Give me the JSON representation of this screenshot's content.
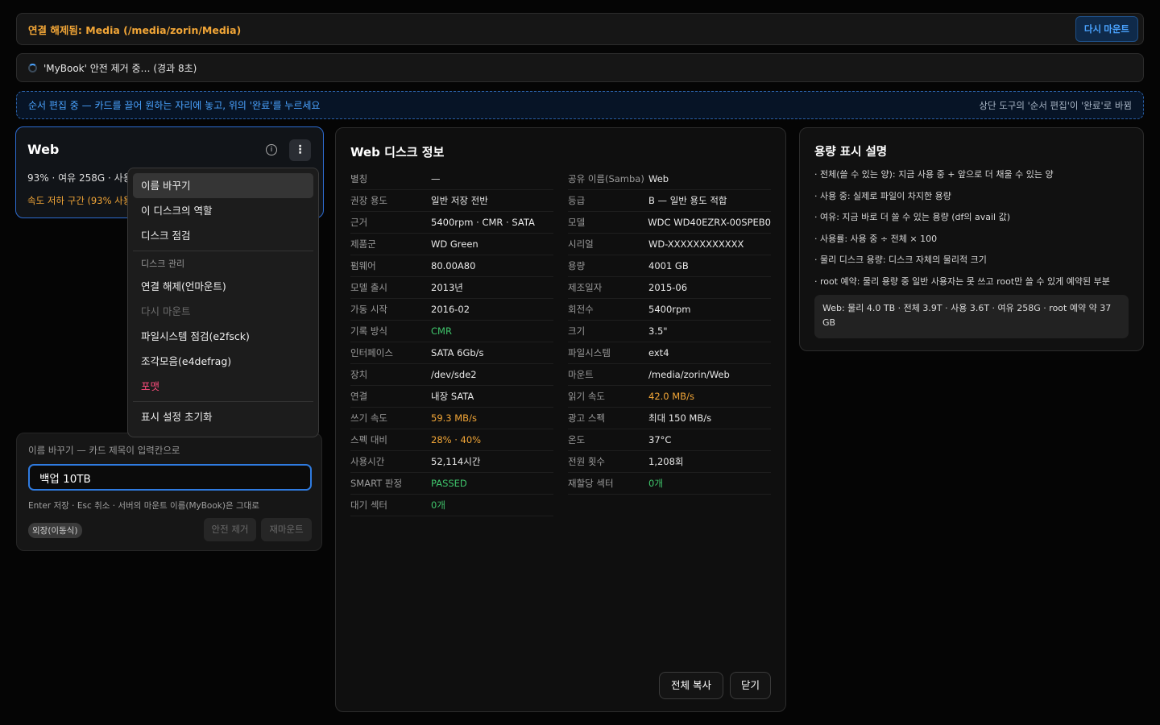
{
  "unmount_bar": {
    "message": "연결 해제됨: Media (/media/zorin/Media)",
    "remount_label": "다시 마운트"
  },
  "eject_bar": {
    "message": "'MyBook' 안전 제거 중… (경과 8초)"
  },
  "order_bar": {
    "left": "순서 편집 중 — 카드를 끌어 원하는 자리에 놓고, 위의 '완료'를 누르세요",
    "right": "상단 도구의 '순서 편집'이 '완료'로 바뀜"
  },
  "web_card": {
    "title": "Web",
    "subtitle": "93% · 여유 258G · 사용",
    "warning": "속도 저하 구간 (93% 사용",
    "info_glyph": "i",
    "kebab_glyph": "⋮"
  },
  "menu": {
    "items_top": [
      "이름 바꾸기",
      "이 디스크의 역할",
      "디스크 점검"
    ],
    "section_header": "디스크 관리",
    "items_manage": [
      "연결 해제(언마운트)",
      "다시 마운트",
      "파일시스템 점검(e2fsck)",
      "조각모음(e4defrag)",
      "포맷"
    ],
    "reset": "표시 설정 초기화"
  },
  "rename_card": {
    "label": "이름 바꾸기 — 카드 제목이 입력칸으로",
    "input_value": "백업 10TB",
    "hint": "Enter 저장 · Esc 취소 · 서버의 마운트 이름(MyBook)은 그대로",
    "badge": "외장(이동식)",
    "eject_label": "안전 제거",
    "remount_label": "재마운트"
  },
  "info_panel": {
    "title": "Web 디스크 정보",
    "left_rows": [
      {
        "k": "별칭",
        "v": "—"
      },
      {
        "k": "권장 용도",
        "v": "일반 저장 전반"
      },
      {
        "k": "근거",
        "v": "5400rpm · CMR · SATA"
      },
      {
        "k": "제품군",
        "v": "WD Green"
      },
      {
        "k": "펌웨어",
        "v": "80.00A80"
      },
      {
        "k": "모델 출시",
        "v": "2013년"
      },
      {
        "k": "가동 시작",
        "v": "2016-02"
      },
      {
        "k": "기록 방식",
        "v": "CMR"
      },
      {
        "k": "인터페이스",
        "v": "SATA 6Gb/s"
      },
      {
        "k": "장치",
        "v": "/dev/sde2"
      },
      {
        "k": "연결",
        "v": "내장 SATA"
      },
      {
        "k": "쓰기 속도",
        "v": "59.3 MB/s"
      },
      {
        "k": "스펙 대비",
        "v": "28% · 40%"
      },
      {
        "k": "사용시간",
        "v": "52,114시간"
      },
      {
        "k": "SMART 판정",
        "v": "PASSED"
      },
      {
        "k": "대기 섹터",
        "v": "0개"
      }
    ],
    "right_rows": [
      {
        "k": "공유 이름(Samba)",
        "v": "Web"
      },
      {
        "k": "등급",
        "v": "B — 일반 용도 적합"
      },
      {
        "k": "모델",
        "v": "WDC WD40EZRX-00SPEB0"
      },
      {
        "k": "시리얼",
        "v": "WD-XXXXXXXXXXXX"
      },
      {
        "k": "용량",
        "v": "4001 GB"
      },
      {
        "k": "제조일자",
        "v": "2015-06"
      },
      {
        "k": "회전수",
        "v": "5400rpm"
      },
      {
        "k": "크기",
        "v": "3.5\""
      },
      {
        "k": "파일시스템",
        "v": "ext4"
      },
      {
        "k": "마운트",
        "v": "/media/zorin/Web"
      },
      {
        "k": "읽기 속도",
        "v": "42.0 MB/s"
      },
      {
        "k": "광고 스펙",
        "v": "최대 150 MB/s"
      },
      {
        "k": "온도",
        "v": "37°C"
      },
      {
        "k": "전원 횟수",
        "v": "1,208회"
      },
      {
        "k": "재할당 섹터",
        "v": "0개"
      }
    ],
    "copy_all": "전체 복사",
    "close": "닫기"
  },
  "capacity_panel": {
    "title": "용량 표시 설명",
    "lines": [
      "· 전체(쓸 수 있는 양): 지금 사용 중 + 앞으로 더 채울 수 있는 양",
      "· 사용 중: 실제로 파일이 차지한 용량",
      "· 여유: 지금 바로 더 쓸 수 있는 용량 (df의 avail 값)",
      "· 사용률: 사용 중 ÷ 전체 × 100",
      "· 물리 디스크 용량: 디스크 자체의 물리적 크기",
      "· root 예약: 물리 용량 중 일반 사용자는 못 쓰고 root만 쓸 수 있게 예약된 부분"
    ],
    "summary": "Web: 물리 4.0 TB · 전체 3.9T · 사용 3.6T · 여유 258G · root 예약 약 37 GB"
  }
}
